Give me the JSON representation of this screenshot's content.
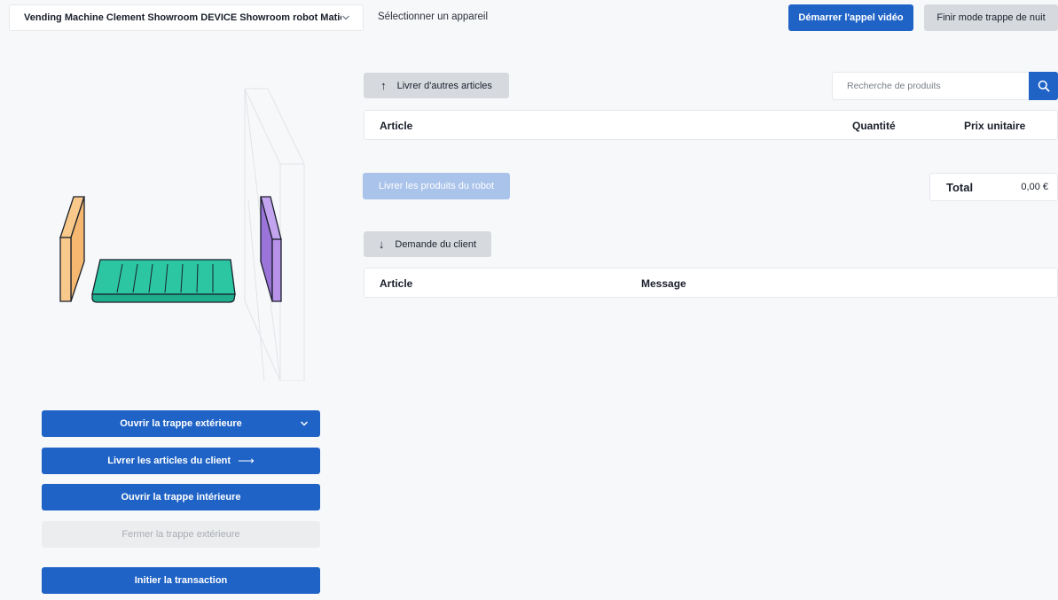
{
  "header": {
    "device_name": "Vending Machine Clement Showroom DEVICE Showroom robot Matic",
    "device_hint": "Sélectionner un appareil",
    "video_call_label": "Démarrer l'appel vidéo",
    "night_mode_label": "Finir mode trappe de nuit"
  },
  "controls": {
    "open_outer_hatch": "Ouvrir la trappe extérieure",
    "deliver_client_items": "Livrer les articles du client",
    "open_inner_hatch": "Ouvrir la trappe intérieure",
    "close_outer_hatch": "Fermer la trappe extérieure",
    "start_transaction": "Initier la transaction"
  },
  "orders": {
    "deliver_more_label": "Livrer d'autres articles",
    "search_placeholder": "Recherche de produits",
    "columns": [
      "Article",
      "Quantité",
      "Prix unitaire"
    ],
    "deliver_robot_label": "Livrer les produits du robot",
    "total_label": "Total",
    "total_value": "0,00 €"
  },
  "client_request": {
    "label": "Demande du client",
    "columns": [
      "Article",
      "Message"
    ]
  },
  "colors": {
    "primary": "#1f63c6",
    "outer_hatch": "#f8c98a",
    "inner_hatch": "#b792e8",
    "conveyor": "#2cc6a3"
  }
}
